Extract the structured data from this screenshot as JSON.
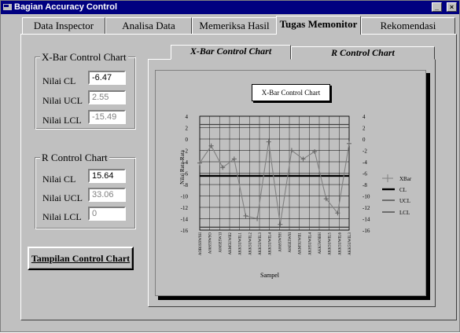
{
  "window": {
    "title": "Bagian Accuracy Control"
  },
  "tabs": [
    {
      "label": "Data Inspector",
      "active": false
    },
    {
      "label": "Analisa Data",
      "active": false
    },
    {
      "label": "Memeriksa Hasil",
      "active": false
    },
    {
      "label": "Tugas Memonitor",
      "active": true
    },
    {
      "label": "Rekomendasi",
      "active": false
    }
  ],
  "xbar_group": {
    "title": "X-Bar Control Chart",
    "cl_label": "Nilai CL",
    "cl_value": "-6.47",
    "ucl_label": "Nilai UCL",
    "ucl_value": "2.55",
    "lcl_label": "Nilai LCL",
    "lcl_value": "-15.49"
  },
  "r_group": {
    "title": "R Control Chart",
    "cl_label": "Nilai CL",
    "cl_value": "15.64",
    "ucl_label": "Nilai UCL",
    "ucl_value": "33.06",
    "lcl_label": "Nilai LCL",
    "lcl_value": "0"
  },
  "show_button": "Tampilan Control Chart",
  "chart_tabs": [
    {
      "label": "X-Bar Control Chart",
      "active": true
    },
    {
      "label": "R Control Chart",
      "active": false
    }
  ],
  "chart_data": {
    "type": "line",
    "title": "X-Bar Control Chart",
    "xlabel": "Sampel",
    "ylabel": "Nilai Rata-Rata",
    "ylim": [
      -16,
      4
    ],
    "yticks": [
      4,
      2,
      0,
      -2,
      -4,
      -6,
      -8,
      -10,
      -12,
      -14,
      -16
    ],
    "categories": [
      "AOR0S9W9H",
      "A06S59W9O",
      "A065E5W1I",
      "AKM5UWII2",
      "AKK5UWIL1",
      "AKK5UWIL2",
      "AKK5UWIL3",
      "AKK5UWIL4",
      "A06S5W9H",
      "A065E5W9I",
      "AKM5UWII1",
      "AKH5UWIL4",
      "AKK5W9BH",
      "AKK5UWIL5",
      "AKK5UWIL6",
      "AKK5UWIL3"
    ],
    "grid": true,
    "legend_position": "right",
    "series": [
      {
        "name": "XBar",
        "values": [
          -4.2,
          -1.2,
          -5.0,
          -3.5,
          -13.5,
          -14.0,
          -0.5,
          -15.0,
          -2.0,
          -3.5,
          -2.2,
          -10.5,
          -13.0,
          -0.8
        ]
      },
      {
        "name": "CL",
        "values": [
          -6.47
        ]
      },
      {
        "name": "UCL",
        "values": [
          2.55
        ]
      },
      {
        "name": "LCL",
        "values": [
          -15.49
        ]
      }
    ]
  },
  "colors": {
    "titlebar": "#000080",
    "face": "#c0c0c0"
  }
}
